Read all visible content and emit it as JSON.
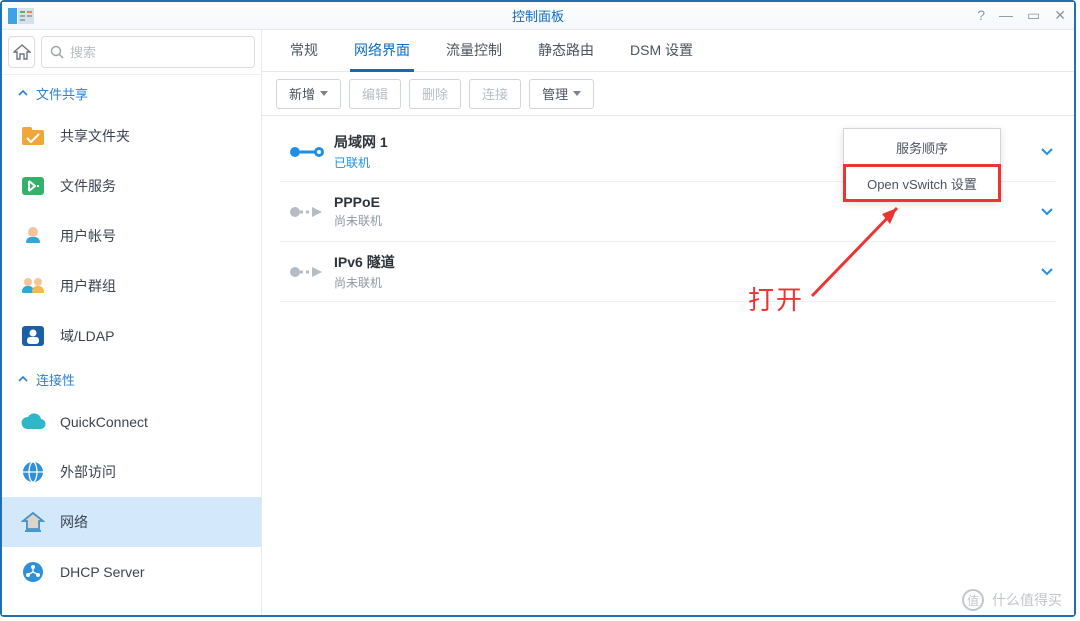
{
  "window": {
    "title": "控制面板"
  },
  "search": {
    "placeholder": "搜索"
  },
  "sidebar": {
    "sections": [
      {
        "label": "文件共享"
      },
      {
        "label": "连接性"
      }
    ],
    "file_sharing": [
      {
        "label": "共享文件夹"
      },
      {
        "label": "文件服务"
      },
      {
        "label": "用户帐号"
      },
      {
        "label": "用户群组"
      },
      {
        "label": "域/LDAP"
      }
    ],
    "connectivity": [
      {
        "label": "QuickConnect"
      },
      {
        "label": "外部访问"
      },
      {
        "label": "网络"
      },
      {
        "label": "DHCP Server"
      }
    ]
  },
  "tabs": [
    {
      "label": "常规"
    },
    {
      "label": "网络界面"
    },
    {
      "label": "流量控制"
    },
    {
      "label": "静态路由"
    },
    {
      "label": "DSM 设置"
    }
  ],
  "toolbar": {
    "add": "新增",
    "edit": "编辑",
    "delete": "删除",
    "connect": "连接",
    "manage": "管理"
  },
  "manage_menu": [
    {
      "label": "服务顺序"
    },
    {
      "label": "Open vSwitch 设置"
    }
  ],
  "interfaces": [
    {
      "title": "局域网 1",
      "status": "已联机",
      "connected": true
    },
    {
      "title": "PPPoE",
      "status": "尚未联机",
      "connected": false
    },
    {
      "title": "IPv6 隧道",
      "status": "尚未联机",
      "connected": false
    }
  ],
  "annotation": {
    "text": "打开"
  },
  "watermark": {
    "text": "什么值得买"
  }
}
